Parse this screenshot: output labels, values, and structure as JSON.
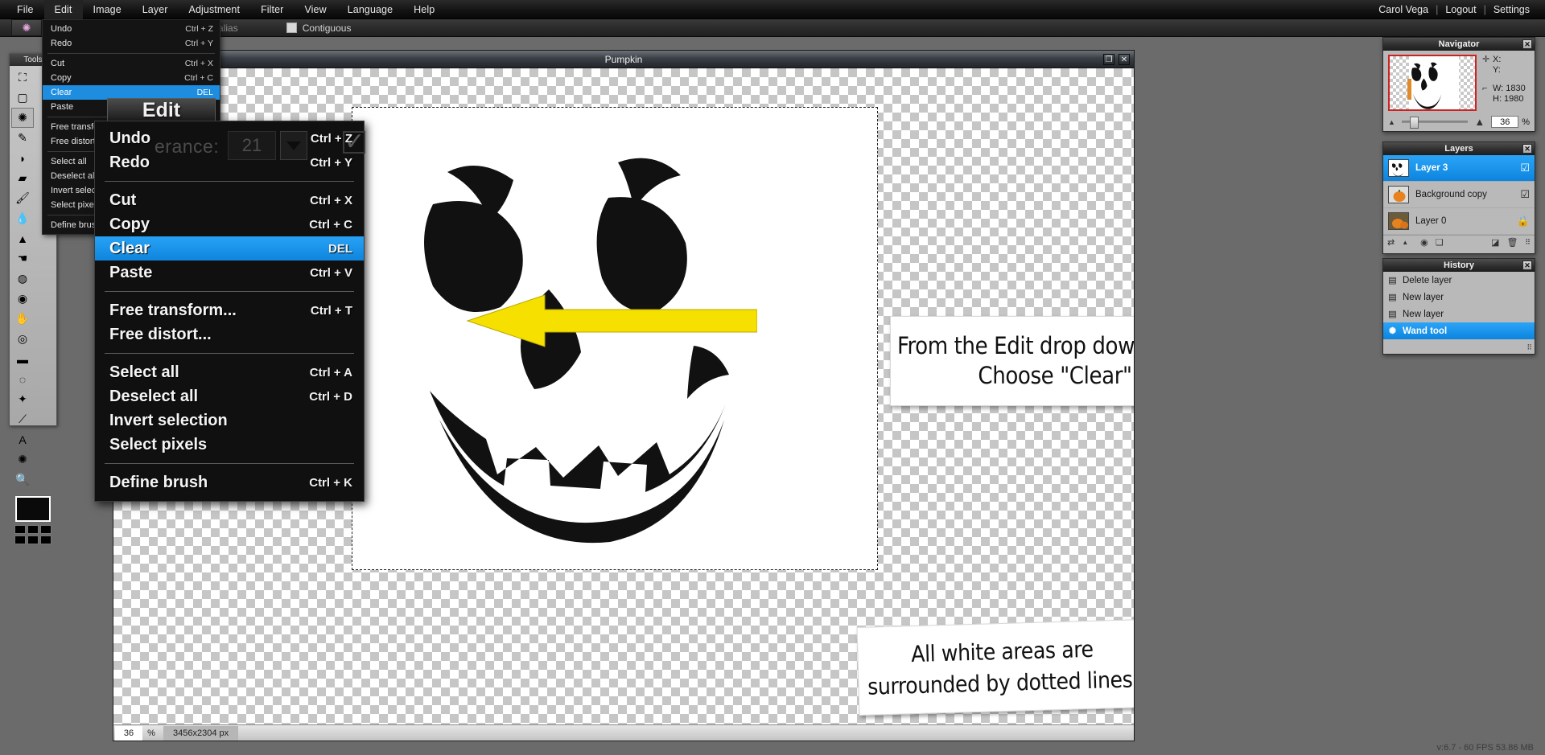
{
  "menubar": {
    "items": [
      "File",
      "Edit",
      "Image",
      "Layer",
      "Adjustment",
      "Filter",
      "View",
      "Language",
      "Help"
    ],
    "active_index": 1,
    "user": "Carol Vega",
    "logout": "Logout",
    "settings": "Settings",
    "sep": "|"
  },
  "optionsbar": {
    "tolerance_label": "Tolerance:",
    "tolerance_value": "21",
    "antialias_label": "Anti-alias",
    "contiguous_label": "Contiguous",
    "dropdown_icon": "chevron-down-icon",
    "tool_icon": "magic-wand-icon"
  },
  "tools": {
    "title": "Tools",
    "items": [
      {
        "name": "crop-tool",
        "glyph": "⛶"
      },
      {
        "name": "marquee-select-tool",
        "glyph": "▢"
      },
      {
        "name": "magic-wand-tool",
        "glyph": "✺"
      },
      {
        "name": "pencil-tool",
        "glyph": "✎"
      },
      {
        "name": "eraser-tool",
        "glyph": "◗"
      },
      {
        "name": "gradient-tool",
        "glyph": "▰"
      },
      {
        "name": "paint-bucket-tool",
        "glyph": "🖌"
      },
      {
        "name": "blur-tool",
        "glyph": "💧"
      },
      {
        "name": "sharpen-tool",
        "glyph": "▲"
      },
      {
        "name": "smudge-tool",
        "glyph": "☚"
      },
      {
        "name": "sponge-tool",
        "glyph": "◍"
      },
      {
        "name": "dodge-tool",
        "glyph": "◉"
      },
      {
        "name": "burn-tool",
        "glyph": "✋"
      },
      {
        "name": "red-eye-tool",
        "glyph": "◎"
      },
      {
        "name": "pill-tool",
        "glyph": "▬"
      },
      {
        "name": "bloat-tool",
        "glyph": "◌"
      },
      {
        "name": "pinch-tool",
        "glyph": "✦"
      },
      {
        "name": "eyedropper-tool",
        "glyph": "⟋"
      },
      {
        "name": "type-tool",
        "glyph": "A"
      },
      {
        "name": "hand-tool",
        "glyph": "✺"
      },
      {
        "name": "zoom-tool",
        "glyph": "🔍"
      }
    ],
    "selected_index": 2,
    "foreground_color": "#0a0a0a"
  },
  "image_window": {
    "title": "Pumpkin",
    "restore_icon": "restore-icon",
    "close_icon": "close-icon",
    "status": {
      "zoom_value": "36",
      "zoom_unit": "%",
      "dimensions": "3456x2304 px"
    }
  },
  "edit_menu_small": {
    "rows": [
      {
        "label": "Undo",
        "shortcut": "Ctrl + Z",
        "highlight": false
      },
      {
        "label": "Redo",
        "shortcut": "Ctrl + Y",
        "highlight": false
      },
      {
        "separator": true
      },
      {
        "label": "Cut",
        "shortcut": "Ctrl + X",
        "highlight": false
      },
      {
        "label": "Copy",
        "shortcut": "Ctrl + C",
        "highlight": false
      },
      {
        "label": "Clear",
        "shortcut": "DEL",
        "highlight": true
      },
      {
        "label": "Paste",
        "shortcut": "Ctrl + V",
        "highlight": false
      },
      {
        "separator": true
      },
      {
        "label": "Free transform...",
        "shortcut": "Ctrl + T",
        "highlight": false
      },
      {
        "label": "Free distort...",
        "shortcut": "",
        "highlight": false
      },
      {
        "separator": true
      },
      {
        "label": "Select all",
        "shortcut": "",
        "highlight": false
      },
      {
        "label": "Deselect all",
        "shortcut": "",
        "highlight": false
      },
      {
        "label": "Invert selection",
        "shortcut": "",
        "highlight": false
      },
      {
        "label": "Select pixels",
        "shortcut": "",
        "highlight": false
      },
      {
        "separator": true
      },
      {
        "label": "Define brush",
        "shortcut": "",
        "highlight": false
      }
    ]
  },
  "edit_menu_magnified": {
    "tab_label": "Edit",
    "ghost_tolerance": "erance:",
    "ghost_value": "21",
    "rows": [
      {
        "label": "Undo",
        "shortcut": "Ctrl + Z",
        "highlight": false
      },
      {
        "label": "Redo",
        "shortcut": "Ctrl + Y",
        "highlight": false
      },
      {
        "separator": true
      },
      {
        "label": "Cut",
        "shortcut": "Ctrl + X",
        "highlight": false
      },
      {
        "label": "Copy",
        "shortcut": "Ctrl + C",
        "highlight": false
      },
      {
        "label": "Clear",
        "shortcut": "DEL",
        "highlight": true
      },
      {
        "label": "Paste",
        "shortcut": "Ctrl + V",
        "highlight": false
      },
      {
        "separator": true
      },
      {
        "label": "Free transform...",
        "shortcut": "Ctrl + T",
        "highlight": false
      },
      {
        "label": "Free distort...",
        "shortcut": "",
        "highlight": false
      },
      {
        "separator": true
      },
      {
        "label": "Select all",
        "shortcut": "Ctrl + A",
        "highlight": false
      },
      {
        "label": "Deselect all",
        "shortcut": "Ctrl + D",
        "highlight": false
      },
      {
        "label": "Invert selection",
        "shortcut": "",
        "highlight": false
      },
      {
        "label": "Select pixels",
        "shortcut": "",
        "highlight": false
      },
      {
        "separator": true
      },
      {
        "label": "Define brush",
        "shortcut": "Ctrl + K",
        "highlight": false
      }
    ]
  },
  "annotations": {
    "callout1_line1": "From the Edit drop down menu",
    "callout1_line2": "Choose \"Clear\"",
    "callout2_line1": "All white areas are",
    "callout2_line2": "surrounded by dotted lines.",
    "arrow_color": "#f5e000"
  },
  "navigator": {
    "title": "Navigator",
    "close_icon": "close-icon",
    "x_label": "X:",
    "y_label": "Y:",
    "x_value": "",
    "y_value": "",
    "w_label": "W: 1830",
    "h_label": "H: 1980",
    "zoom_value": "36",
    "zoom_unit": "%",
    "zoom_out_icon": "zoom-out-icon",
    "zoom_in_icon": "zoom-in-icon",
    "crosshair_icon": "crosshair-icon",
    "selection-size-icon": "selection-size-icon"
  },
  "layers": {
    "title": "Layers",
    "close_icon": "close-icon",
    "rows": [
      {
        "name": "Layer 3",
        "visible": true,
        "selected": true,
        "locked": false
      },
      {
        "name": "Background copy",
        "visible": true,
        "selected": false,
        "locked": false
      },
      {
        "name": "Layer 0",
        "visible": false,
        "selected": false,
        "locked": true
      }
    ],
    "footer_icons": [
      "blend-mode-icon",
      "expand-arrow-icon",
      "mask-icon",
      "new-layer-icon",
      "merge-down-icon",
      "delete-layer-icon",
      "resize-grip-icon"
    ]
  },
  "history": {
    "title": "History",
    "close_icon": "close-icon",
    "rows": [
      {
        "label": "Delete layer",
        "icon": "history-doc-icon",
        "selected": false
      },
      {
        "label": "New layer",
        "icon": "history-doc-icon",
        "selected": false
      },
      {
        "label": "New layer",
        "icon": "history-doc-icon",
        "selected": false
      },
      {
        "label": "Wand tool",
        "icon": "magic-wand-icon",
        "selected": true
      }
    ]
  },
  "footer": {
    "version_info": "v:6.7 - 60 FPS 53.86 MB"
  }
}
